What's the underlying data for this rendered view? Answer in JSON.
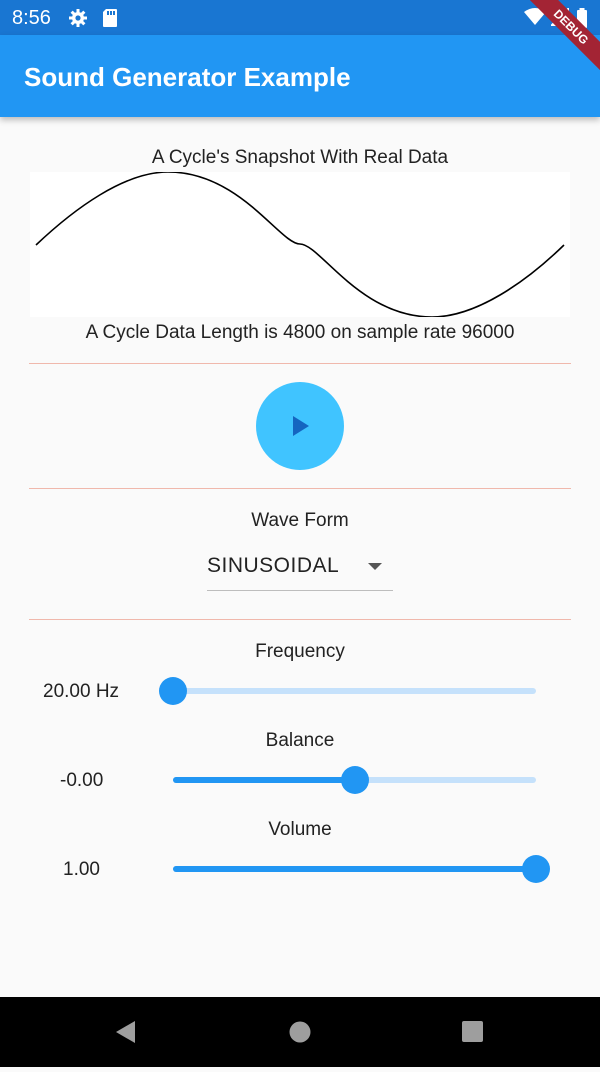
{
  "status_bar": {
    "time": "8:56"
  },
  "debug_banner": "DEBUG",
  "app_bar": {
    "title": "Sound Generator Example"
  },
  "snapshot": {
    "title": "A Cycle's Snapshot With Real Data",
    "caption": "A Cycle Data Length is 4800 on sample rate 96000"
  },
  "waveform": {
    "label": "Wave Form",
    "selected": "SINUSOIDAL"
  },
  "sliders": {
    "frequency": {
      "label": "Frequency",
      "value_text": "20.00 Hz",
      "fraction": 0.0
    },
    "balance": {
      "label": "Balance",
      "value_text": "-0.00",
      "fraction": 0.5
    },
    "volume": {
      "label": "Volume",
      "value_text": "1.00",
      "fraction": 1.0
    }
  },
  "colors": {
    "app_bar": "#2196f3",
    "status_bar": "#1976d2",
    "accent": "#40c4ff",
    "slider_active": "#2196f3",
    "slider_inactive": "#c5e1fb",
    "divider": "#f0b8ac",
    "debug_banner": "#a32434"
  },
  "icons": {
    "status_left": [
      "gear-icon",
      "sd-card-icon"
    ],
    "status_right": [
      "wifi-icon",
      "signal-icon",
      "battery-icon"
    ],
    "play": "play-icon",
    "dropdown": "dropdown-arrow-icon",
    "nav": [
      "back-icon",
      "home-icon",
      "recents-icon"
    ]
  }
}
